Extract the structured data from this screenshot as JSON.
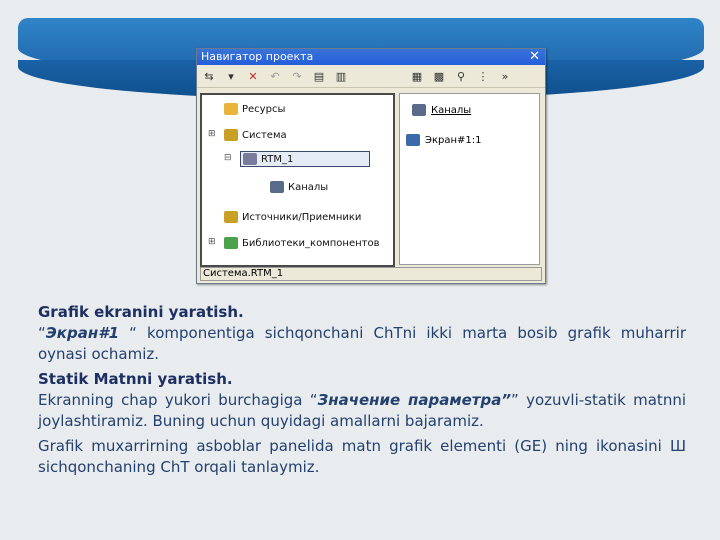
{
  "window": {
    "title": "Навигатор проекта",
    "close_glyph": "✕",
    "toolbar_left": [
      "⇆",
      "▾",
      "✕",
      "↶",
      "↷",
      "▤",
      "▥"
    ],
    "toolbar_right": [
      "▦",
      "▩",
      "⚲",
      "⋮",
      "»"
    ],
    "tree": [
      {
        "label": "Ресурсы",
        "icon": "folder-icon",
        "color": "#e8b53a"
      },
      {
        "label": "Система",
        "icon": "system-icon",
        "color": "#c8a028"
      },
      {
        "label": "RTM_1",
        "icon": "rtm-icon",
        "color": "#7a7a9a"
      },
      {
        "label": "Каналы",
        "icon": "channels-icon",
        "color": "#5a6a8a"
      },
      {
        "label": "Источники/Приемники",
        "icon": "sources-icon",
        "color": "#c8a028"
      },
      {
        "label": "Библиотеки_компонентов",
        "icon": "library-icon",
        "color": "#4aa34a"
      }
    ],
    "list": [
      {
        "label": "Каналы",
        "icon": "channels-icon"
      },
      {
        "label": "Экран#1:1",
        "icon": "screen-icon"
      }
    ],
    "status": "Система.RTM_1"
  },
  "text": {
    "h1": "Grafik ekranini yaratish.",
    "p1_quote_open": "“",
    "p1_em": "Экран#1",
    "p1_rest": " “ komponentiga sichqonchani ChTni ikki marta bosib grafik muharrir oynasi ochamiz.",
    "h2": "Statik Matnni yaratish.",
    "p2_a": "Ekranning chap yukori burchagiga “",
    "p2_em": "Значение параметра”",
    "p2_b": "” yozuvli-statik matnni joylashtiramiz. Buning uchun quyidagi amallarni bajaramiz.",
    "p3": "Grafik muxarrirning asboblar panelida matn grafik elementi (GE) ning ikonasini Ш sichqonchaning ChT orqali tanlaymiz."
  }
}
